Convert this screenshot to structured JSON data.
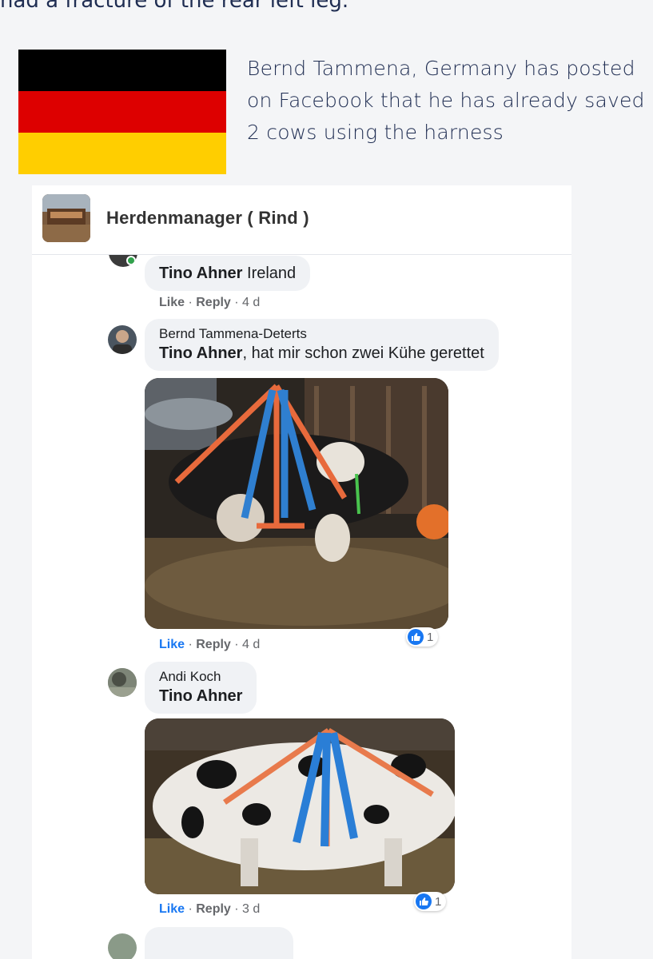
{
  "intro_cut_text": "had a fracture of the rear left leg.",
  "headline": "Bernd Tammena, Germany has posted on Facebook that he has already saved 2 cows using the harness",
  "flag_colors": [
    "#000000",
    "#dd0000",
    "#ffce00"
  ],
  "group": {
    "name": "Herdenmanager ( Rind )"
  },
  "comments": [
    {
      "author": "Tino Ahner",
      "text": "Ireland",
      "actions": {
        "like": "Like",
        "reply": "Reply",
        "time": "4 d"
      }
    },
    {
      "author": "Bernd Tammena-Deterts",
      "mention": "Tino Ahner",
      "text": ", hat mir schon zwei Kühe gerettet",
      "actions": {
        "like": "Like",
        "reply": "Reply",
        "time": "4 d"
      },
      "reaction_count": "1"
    },
    {
      "author": "Andi Koch",
      "mention": "Tino Ahner",
      "actions": {
        "like": "Like",
        "reply": "Reply",
        "time": "3 d"
      },
      "reaction_count": "1"
    }
  ],
  "icons": {
    "reaction": "like-thumb-icon"
  }
}
